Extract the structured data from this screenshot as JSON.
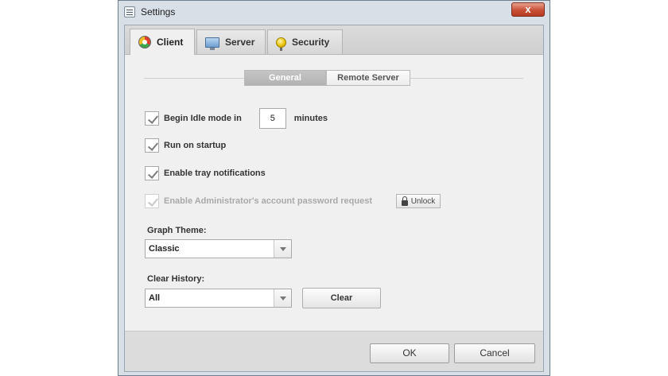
{
  "window": {
    "title": "Settings",
    "close_symbol": "x"
  },
  "tabs": [
    {
      "label": "Client",
      "icon": "client-icon",
      "active": true
    },
    {
      "label": "Server",
      "icon": "server-icon",
      "active": false
    },
    {
      "label": "Security",
      "icon": "security-icon",
      "active": false
    }
  ],
  "subtabs": [
    {
      "label": "General",
      "active": true
    },
    {
      "label": "Remote Server",
      "active": false
    }
  ],
  "options": {
    "idle_mode": {
      "label": "Begin Idle mode in",
      "value": "5",
      "unit": "minutes",
      "checked": true
    },
    "run_on_startup": {
      "label": "Run on startup",
      "checked": true
    },
    "tray_notifications": {
      "label": "Enable tray notifications",
      "checked": true
    },
    "admin_password": {
      "label": "Enable Administrator's account password request",
      "checked": true,
      "disabled": true
    },
    "unlock_label": "Unlock"
  },
  "graph_theme": {
    "label": "Graph Theme:",
    "selected": "Classic"
  },
  "clear_history": {
    "label": "Clear History:",
    "selected": "All",
    "button_label": "Clear"
  },
  "footer": {
    "ok_label": "OK",
    "cancel_label": "Cancel"
  }
}
